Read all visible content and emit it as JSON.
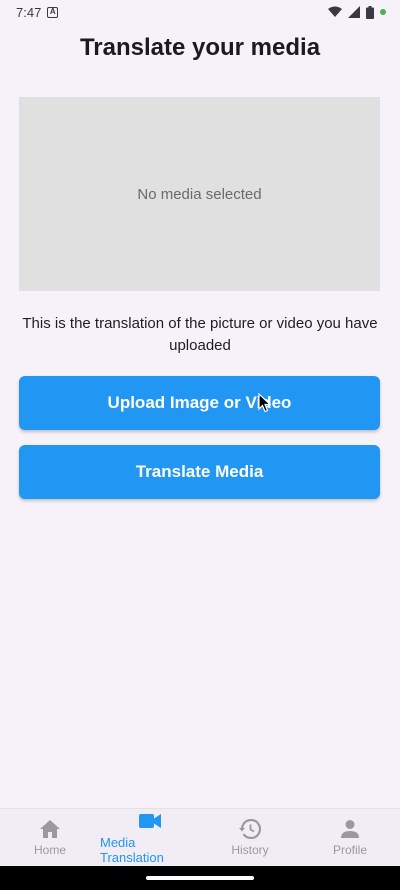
{
  "status_bar": {
    "time": "7:47",
    "notification_letter": "A",
    "dot_color": "#4caf50"
  },
  "page": {
    "title": "Translate your media",
    "media_placeholder": "No media selected",
    "description": "This is the translation of the picture or video you have uploaded"
  },
  "buttons": {
    "upload_label": "Upload Image or Video",
    "translate_label": "Translate Media"
  },
  "colors": {
    "accent": "#2196f3",
    "background": "#f7f2f9",
    "media_box": "#e0e0e0",
    "nav_inactive": "#9b98a0"
  },
  "bottom_nav": {
    "items": [
      {
        "label": "Home",
        "icon": "home-icon",
        "active": false
      },
      {
        "label": "Media Translation",
        "icon": "videocam-icon",
        "active": true
      },
      {
        "label": "History",
        "icon": "history-icon",
        "active": false
      },
      {
        "label": "Profile",
        "icon": "person-icon",
        "active": false
      }
    ]
  }
}
